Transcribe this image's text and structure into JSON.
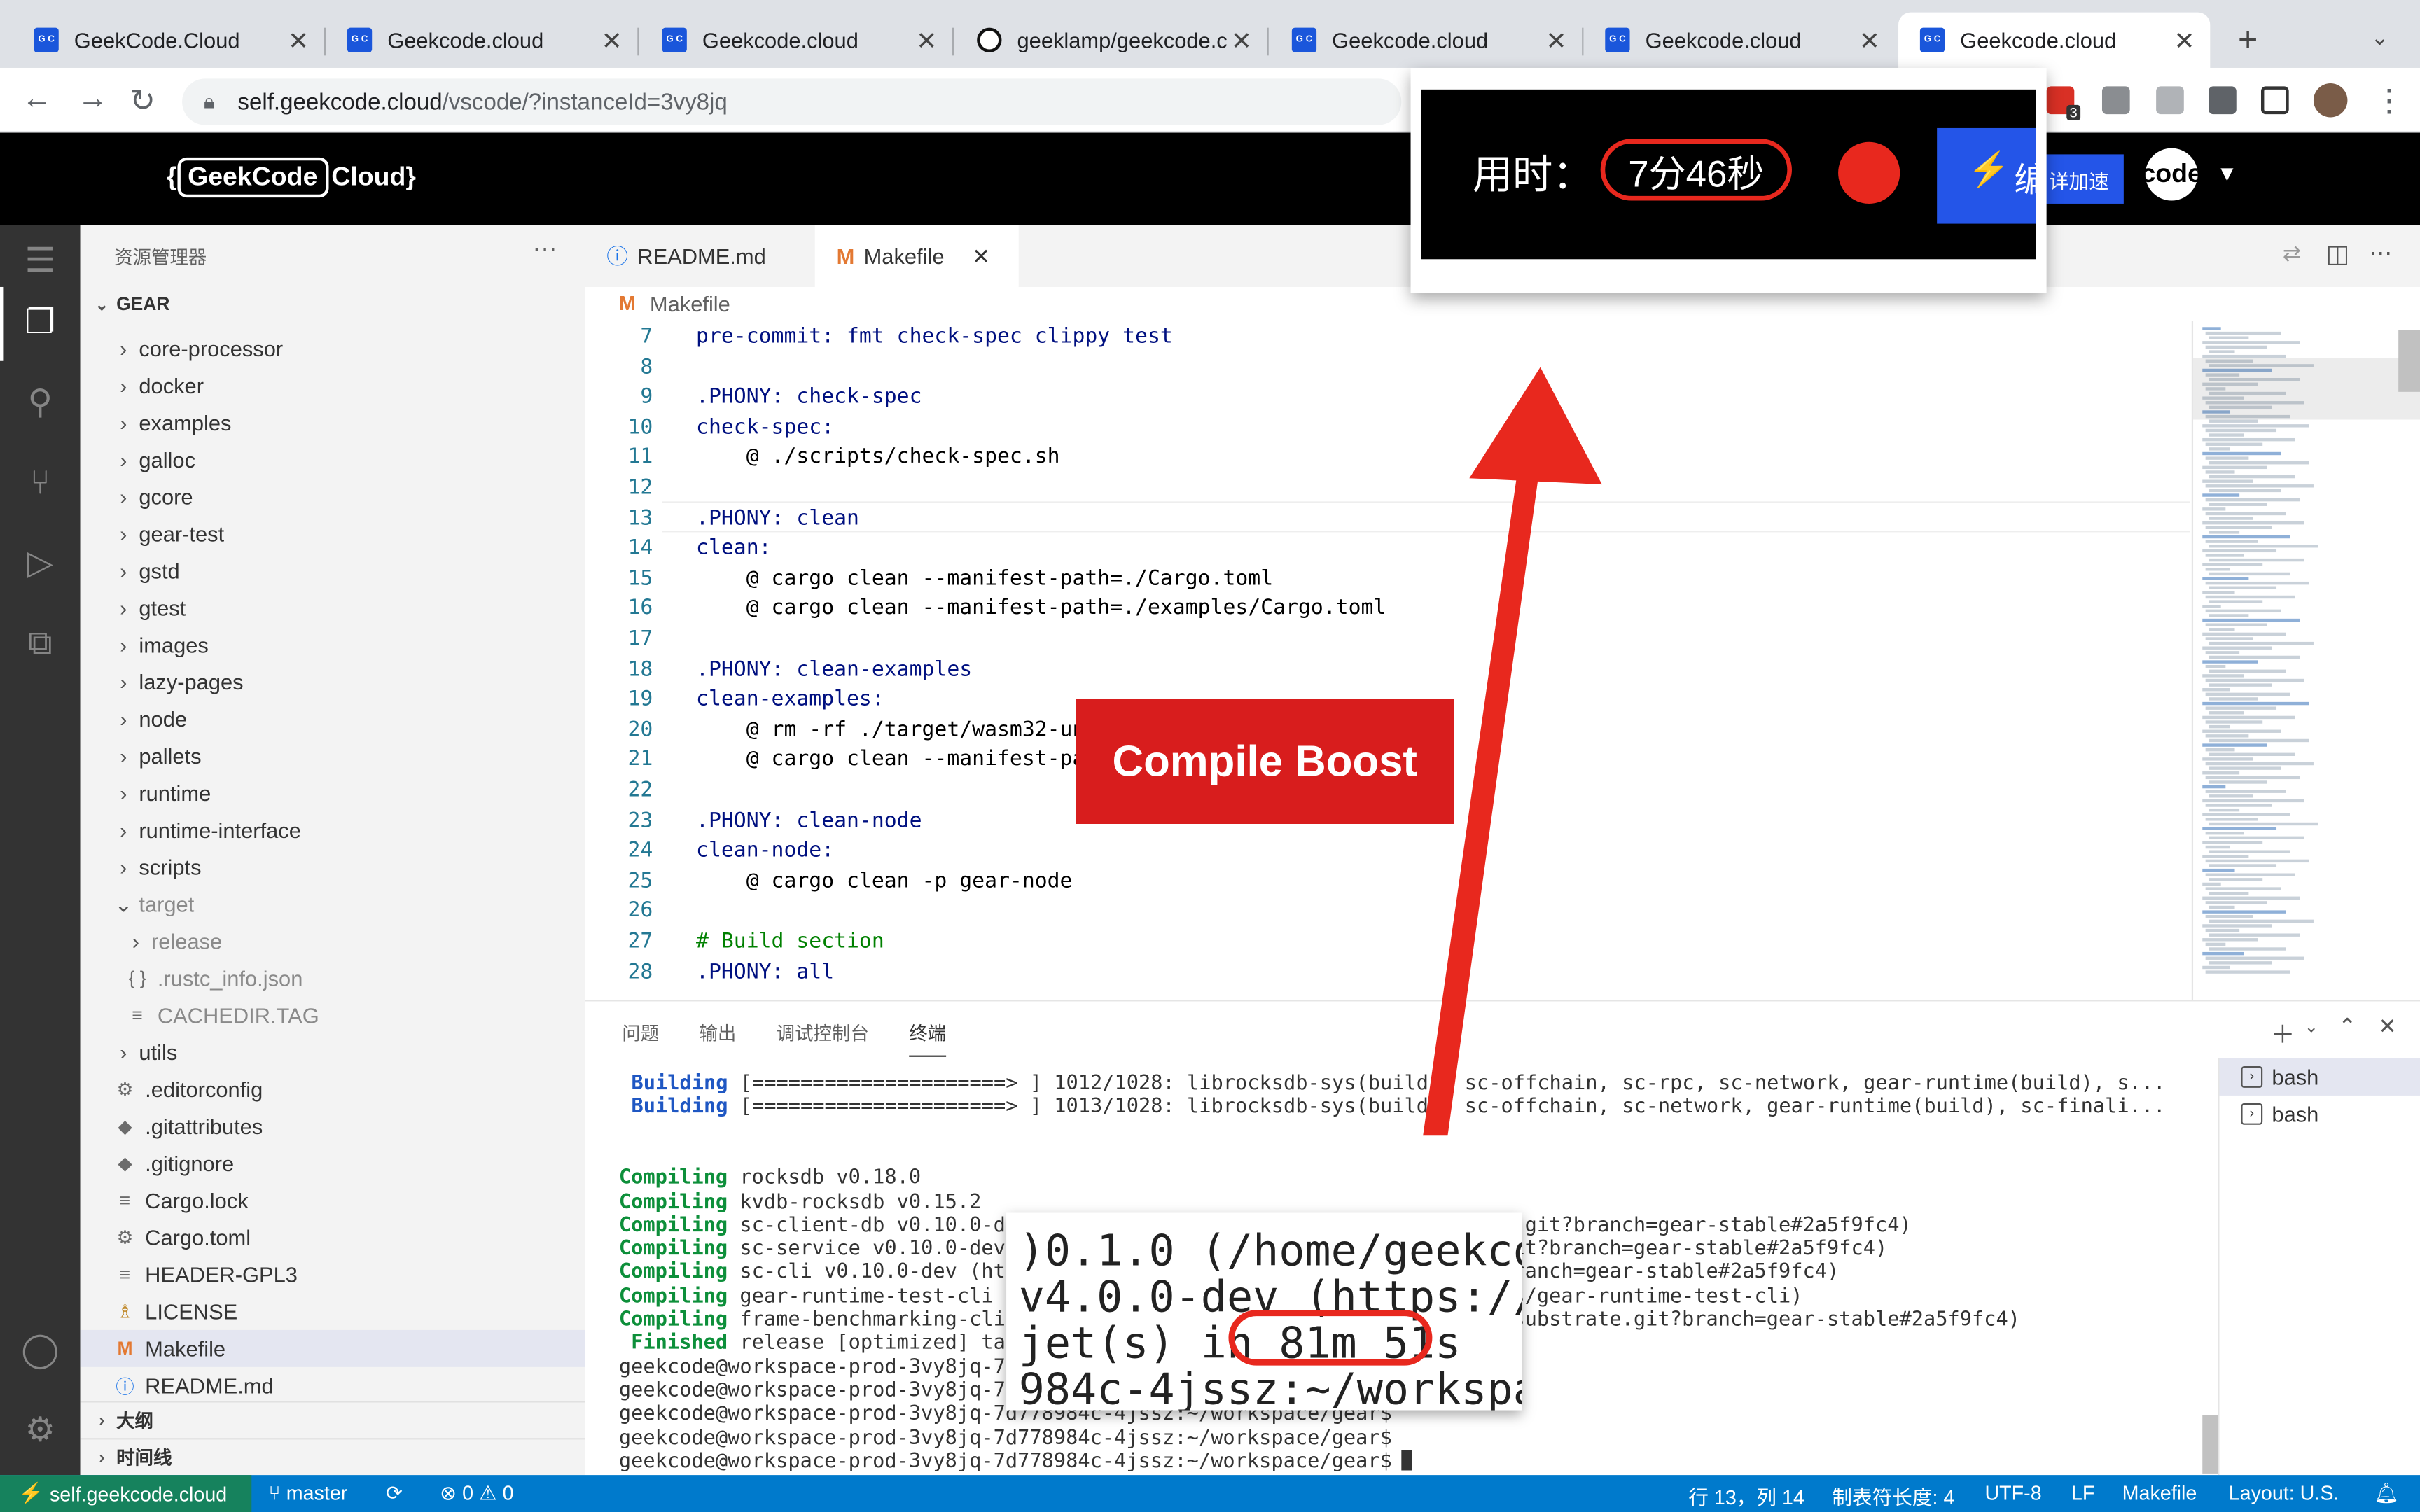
{
  "browser": {
    "tabs": [
      {
        "title": "GeekCode.Cloud",
        "icon": "geekcode-favicon"
      },
      {
        "title": "Geekcode.cloud",
        "icon": "geekcode-favicon"
      },
      {
        "title": "Geekcode.cloud",
        "icon": "geekcode-favicon"
      },
      {
        "title": "geeklamp/geekcode.c",
        "icon": "github-favicon"
      },
      {
        "title": "Geekcode.cloud",
        "icon": "geekcode-favicon"
      },
      {
        "title": "Geekcode.cloud",
        "icon": "geekcode-favicon"
      },
      {
        "title": "Geekcode.cloud",
        "icon": "geekcode-favicon"
      }
    ],
    "url_host": "self.geekcode.cloud",
    "url_path": "/vscode/?instanceId=3vy8jq",
    "new_tab": "+",
    "tab_close": "✕",
    "extension_badge": "3"
  },
  "app": {
    "logo_boxed": "GeekCode",
    "logo_rest": "Cloud}",
    "logo_open": "{",
    "boost_button": "详加速",
    "user_label": "code"
  },
  "timer": {
    "label": "用时：",
    "value": "7分46秒",
    "boost_glyph": "⚡",
    "boost_text": "编"
  },
  "sidebar": {
    "title": "资源管理器",
    "more": "···",
    "folder": "GEAR",
    "items": [
      {
        "label": "core-processor",
        "type": "folder"
      },
      {
        "label": "docker",
        "type": "folder"
      },
      {
        "label": "examples",
        "type": "folder"
      },
      {
        "label": "galloc",
        "type": "folder"
      },
      {
        "label": "gcore",
        "type": "folder"
      },
      {
        "label": "gear-test",
        "type": "folder"
      },
      {
        "label": "gstd",
        "type": "folder"
      },
      {
        "label": "gtest",
        "type": "folder"
      },
      {
        "label": "images",
        "type": "folder"
      },
      {
        "label": "lazy-pages",
        "type": "folder"
      },
      {
        "label": "node",
        "type": "folder"
      },
      {
        "label": "pallets",
        "type": "folder"
      },
      {
        "label": "runtime",
        "type": "folder"
      },
      {
        "label": "runtime-interface",
        "type": "folder"
      },
      {
        "label": "scripts",
        "type": "folder"
      },
      {
        "label": "target",
        "type": "folder-open"
      },
      {
        "label": "release",
        "type": "subfolder"
      },
      {
        "label": ".rustc_info.json",
        "type": "json"
      },
      {
        "label": "CACHEDIR.TAG",
        "type": "file"
      },
      {
        "label": "utils",
        "type": "folder"
      },
      {
        "label": ".editorconfig",
        "type": "gear"
      },
      {
        "label": ".gitattributes",
        "type": "git"
      },
      {
        "label": ".gitignore",
        "type": "git"
      },
      {
        "label": "Cargo.lock",
        "type": "file"
      },
      {
        "label": "Cargo.toml",
        "type": "gear"
      },
      {
        "label": "HEADER-GPL3",
        "type": "file"
      },
      {
        "label": "LICENSE",
        "type": "license"
      },
      {
        "label": "Makefile",
        "type": "makefile"
      },
      {
        "label": "README.md",
        "type": "info"
      }
    ],
    "outline": "大纲",
    "timeline": "时间线"
  },
  "editor": {
    "tabs": [
      {
        "label": "README.md",
        "icon": "info-icon"
      },
      {
        "label": "Makefile",
        "icon": "makefile-icon"
      }
    ],
    "breadcrumb": "Makefile",
    "lines": [
      {
        "n": "7",
        "text": "pre-commit: fmt check-spec clippy test"
      },
      {
        "n": "8",
        "text": ""
      },
      {
        "n": "9",
        "text": ".PHONY: check-spec"
      },
      {
        "n": "10",
        "text": "check-spec:"
      },
      {
        "n": "11",
        "text": "    @ ./scripts/check-spec.sh"
      },
      {
        "n": "12",
        "text": ""
      },
      {
        "n": "13",
        "text": ".PHONY: clean"
      },
      {
        "n": "14",
        "text": "clean:"
      },
      {
        "n": "15",
        "text": "    @ cargo clean --manifest-path=./Cargo.toml"
      },
      {
        "n": "16",
        "text": "    @ cargo clean --manifest-path=./examples/Cargo.toml"
      },
      {
        "n": "17",
        "text": ""
      },
      {
        "n": "18",
        "text": ".PHONY: clean-examples"
      },
      {
        "n": "19",
        "text": "clean-examples:"
      },
      {
        "n": "20",
        "text": "    @ rm -rf ./target/wasm32-unk"
      },
      {
        "n": "21",
        "text": "    @ cargo clean --manifest-pat"
      },
      {
        "n": "22",
        "text": ""
      },
      {
        "n": "23",
        "text": ".PHONY: clean-node"
      },
      {
        "n": "24",
        "text": "clean-node:"
      },
      {
        "n": "25",
        "text": "    @ cargo clean -p gear-node"
      },
      {
        "n": "26",
        "text": ""
      },
      {
        "n": "27",
        "text": "# Build section"
      },
      {
        "n": "28",
        "text": ".PHONY: all"
      }
    ]
  },
  "panel": {
    "tabs": [
      "问题",
      "输出",
      "调试控制台",
      "终端"
    ],
    "active_tab": "终端",
    "terminal_lines": [
      {
        "tag": "Building",
        "text": " [=====================> ] 1012/1028: librocksdb-sys(build), sc-offchain, sc-rpc, sc-network, gear-runtime(build), s..."
      },
      {
        "tag": "Building",
        "text": " [=====================> ] 1013/1028: librocksdb-sys(build), sc-offchain, sc-network, gear-runtime(build), sc-finali..."
      },
      {
        "tag": "",
        "text": ""
      },
      {
        "tag": "",
        "text": ""
      },
      {
        "tag": "Compiling",
        "text": " rocksdb v0.18.0"
      },
      {
        "tag": "Compiling",
        "text": " kvdb-rocksdb v0.15.2"
      },
      {
        "tag": "Compiling",
        "text": " sc-client-db v0.10.0-dev (https://github.com/gear-tech/substrate.git?branch=gear-stable#2a5f9fc4)"
      },
      {
        "tag": "Compiling",
        "text": " sc-service v0.10.0-dev (https://github.com/gear-tech/substrate.git?branch=gear-stable#2a5f9fc4)"
      },
      {
        "tag": "Compiling",
        "text": " sc-cli v0.10.0-dev (https://github.com/gear-tech/substrate.git?branch=gear-stable#2a5f9fc4)"
      },
      {
        "tag": "Compiling",
        "text": " gear-runtime-test-cli v0.1.0 (/home/geekcode/workspace/gear/utils/gear-runtime-test-cli)"
      },
      {
        "tag": "Compiling",
        "text": " frame-benchmarking-cli v4.0.0-dev (https://github.com/gear-tech/substrate.git?branch=gear-stable#2a5f9fc4)"
      },
      {
        "tag": " Finished",
        "text": " release [optimized] target(s) in 81m 51s"
      },
      {
        "tag": "",
        "text": "geekcode@workspace-prod-3vy8jq-7d778984c-4jssz:~/workspace/gear$"
      },
      {
        "tag": "",
        "text": "geekcode@workspace-prod-3vy8jq-7d778984c-4jssz:~/workspace/gear$"
      },
      {
        "tag": "",
        "text": "geekcode@workspace-prod-3vy8jq-7d778984c-4jssz:~/workspace/gear$"
      },
      {
        "tag": "",
        "text": "geekcode@workspace-prod-3vy8jq-7d778984c-4jssz:~/workspace/gear$"
      },
      {
        "tag": "",
        "text": "geekcode@workspace-prod-3vy8jq-7d778984c-4jssz:~/workspace/gear$"
      }
    ],
    "terminals": [
      "bash",
      "bash"
    ]
  },
  "zoom": {
    "lines": [
      ")0.1.0 (/home/geekcode/",
      "v4.0.0-dev (https://gi",
      "jet(s) in ",
      "984c-4jssz:~/workspace"
    ],
    "duration": "81m 51s"
  },
  "annotation": {
    "compile_boost": "Compile Boost"
  },
  "statusbar": {
    "remote": "self.geekcode.cloud",
    "branch": "master",
    "problems": "⊗ 0 ⚠ 0",
    "cursor": "行 13，列 14",
    "tabsize": "制表符长度: 4",
    "encoding": "UTF-8",
    "eol": "LF",
    "language": "Makefile",
    "layout": "Layout: U.S."
  },
  "colors": {
    "accent_blue": "#007acc",
    "remote_green": "#16825d",
    "annotation_red": "#e8281e",
    "boost_blue": "#2455e8"
  }
}
